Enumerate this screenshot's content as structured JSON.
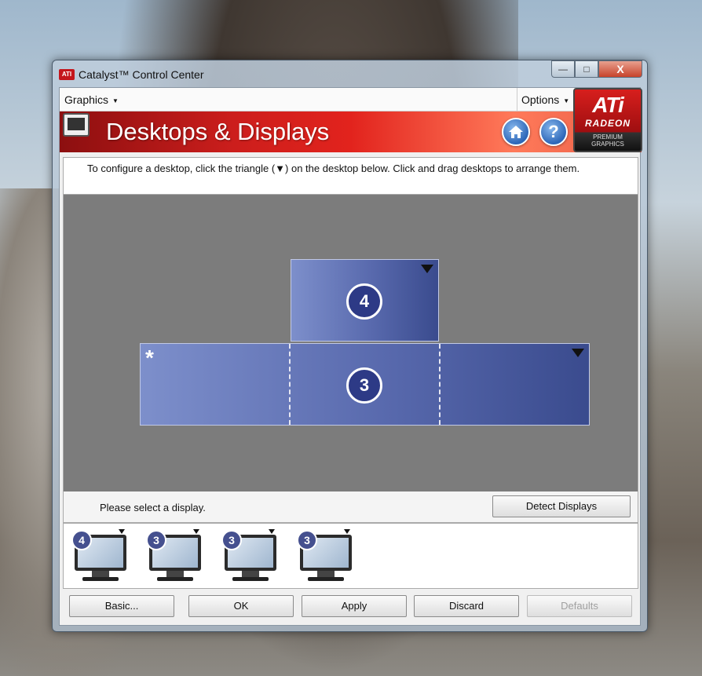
{
  "window": {
    "title": "Catalyst™ Control Center",
    "app_icon": "ATI",
    "controls": {
      "minimize": "—",
      "maximize": "□",
      "close": "X"
    }
  },
  "menu": {
    "graphics_label": "Graphics",
    "options_label": "Options"
  },
  "banner": {
    "title": "Desktops & Displays",
    "home_icon": "home-icon",
    "help_icon": "?"
  },
  "logo": {
    "brand": "ATi",
    "product": "RADEON",
    "tagline_1": "PREMIUM",
    "tagline_2": "GRAPHICS"
  },
  "instruction": "To configure a desktop, click the triangle (▼) on the desktop below.  Click and drag desktops to arrange them.",
  "desktops": [
    {
      "number": "4",
      "primary": false
    },
    {
      "number": "3",
      "primary": true,
      "primary_marker": "*"
    }
  ],
  "status": {
    "text": "Please select a display.",
    "detect_button": "Detect Displays"
  },
  "display_thumbnails": [
    {
      "number": "4"
    },
    {
      "number": "3"
    },
    {
      "number": "3"
    },
    {
      "number": "3"
    }
  ],
  "buttons": {
    "basic": "Basic...",
    "ok": "OK",
    "apply": "Apply",
    "discard": "Discard",
    "defaults": "Defaults"
  },
  "colors": {
    "banner_red": "#e2231d",
    "desktop_blue": "#5869ad",
    "badge_navy": "#2d3a86",
    "canvas_gray": "#7c7c7c"
  }
}
